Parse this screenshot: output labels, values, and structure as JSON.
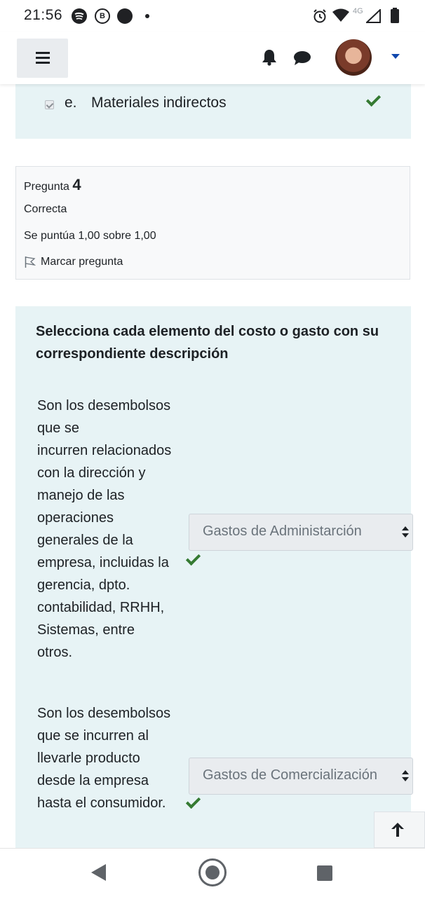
{
  "status_bar": {
    "time": "21:56",
    "network": "4G",
    "icons": [
      "spotify-icon",
      "b-badge-icon",
      "black-circle-icon",
      "notification-dot-icon",
      "alarm-icon",
      "wifi-icon",
      "signal-icon",
      "battery-icon"
    ]
  },
  "navbar": {
    "icons": [
      "menu-icon",
      "bell-icon",
      "chat-icon",
      "avatar",
      "caret-down-icon"
    ]
  },
  "previous_answer": {
    "letter": "e.",
    "text": "Materiales indirectos",
    "checked": true,
    "correct": true
  },
  "question_info": {
    "label": "Pregunta",
    "number": "4",
    "state": "Correcta",
    "grade": "Se puntúa 1,00 sobre 1,00",
    "flag_label": "Marcar pregunta"
  },
  "question": {
    "text": "Selecciona cada elemento del costo o gasto con su correspondiente descripción",
    "items": [
      {
        "description": "Son los desembolsos\nque  se\nincurren relacionados\ncon la dirección y\nmanejo de las\noperaciones\ngenerales de la\nempresa, incluidas la\ngerencia, dpto.\ncontabilidad, RRHH,\nSistemas, entre\notros.",
        "selected": "Gastos de Administarción",
        "correct": true
      },
      {
        "description": "Son los desembolsos\nque  se incurren al\nllevarle producto\ndesde la empresa\nhasta el consumidor.",
        "selected": "Gastos de Comercialización",
        "correct": true
      }
    ]
  },
  "colors": {
    "content_bg": "#e7f3f5",
    "correct_green": "#357a32",
    "select_bg": "#e9ecef",
    "info_bg": "#f8f9fa",
    "caret_blue": "#0f47ad"
  },
  "system_nav": {
    "icons": [
      "back-icon",
      "home-icon",
      "recents-icon"
    ]
  }
}
